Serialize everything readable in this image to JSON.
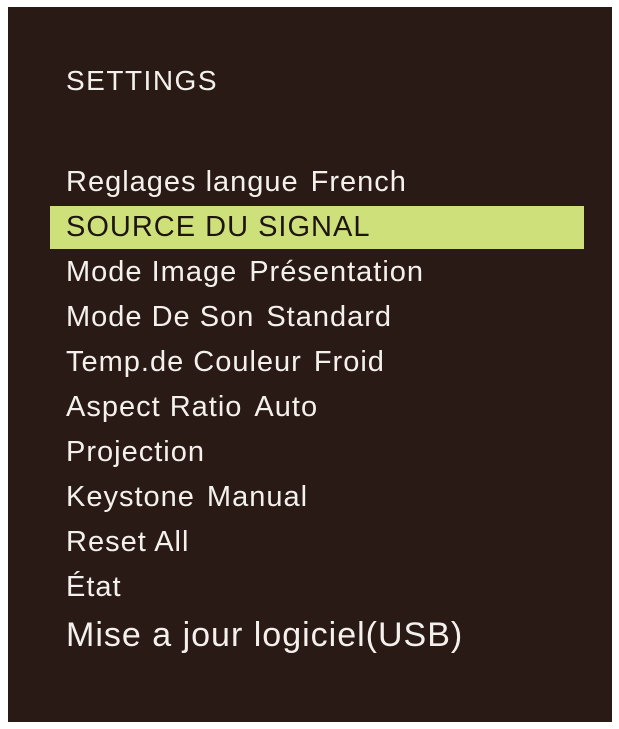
{
  "title": "SETTINGS",
  "colors": {
    "panel_background": "#2a1a16",
    "text": "#f4f1ec",
    "highlight": "#cde07a",
    "highlight_text": "#1e1410"
  },
  "menu": {
    "selected_index": 1,
    "items": [
      {
        "label": "Reglages langue",
        "value": "French"
      },
      {
        "label": "SOURCE DU SIGNAL",
        "value": ""
      },
      {
        "label": "Mode Image",
        "value": "Présentation"
      },
      {
        "label": "Mode De Son",
        "value": "Standard"
      },
      {
        "label": "Temp.de Couleur",
        "value": "Froid"
      },
      {
        "label": "Aspect Ratio",
        "value": "Auto"
      },
      {
        "label": "Projection",
        "value": ""
      },
      {
        "label": "Keystone",
        "value": "Manual"
      },
      {
        "label": "Reset All",
        "value": ""
      },
      {
        "label": "État",
        "value": ""
      },
      {
        "label": "Mise a jour logiciel(USB)",
        "value": ""
      }
    ]
  }
}
